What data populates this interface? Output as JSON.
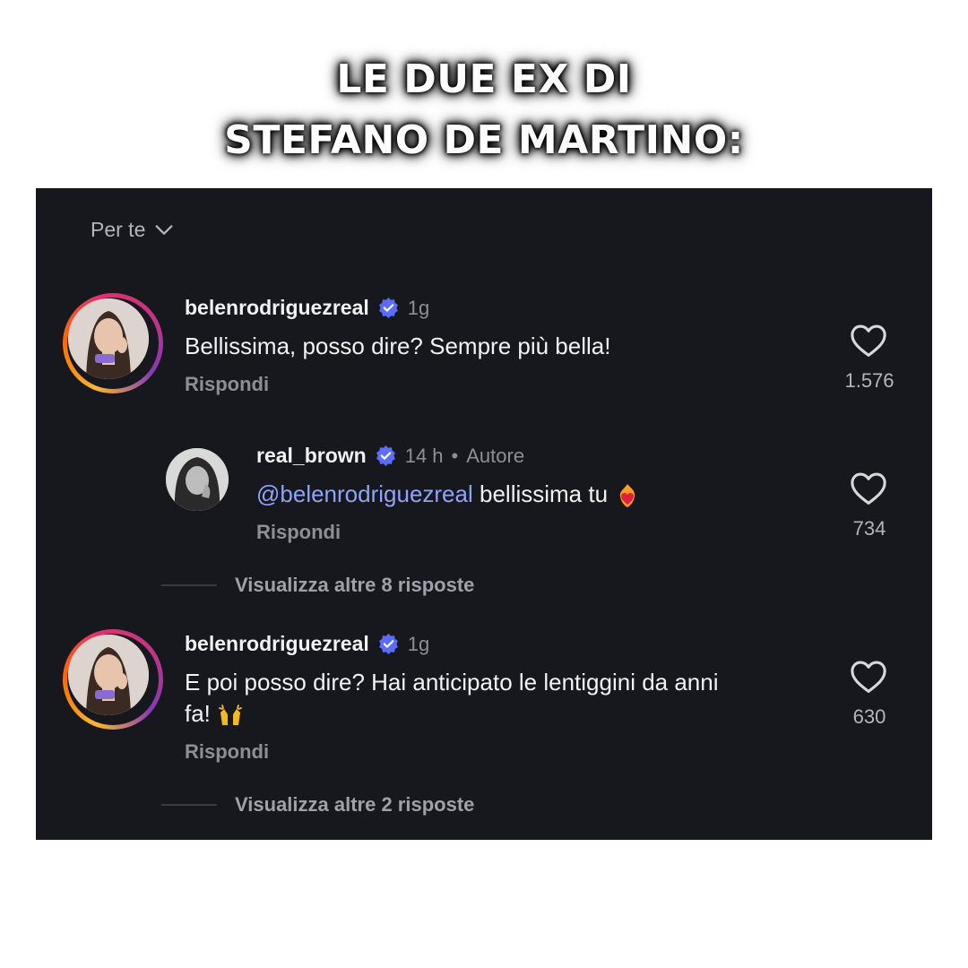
{
  "headline": {
    "line1": "LE DUE EX DI",
    "line2": "STEFANO DE MARTINO:"
  },
  "filter": {
    "label": "Per te",
    "icon": "chevron-down-icon"
  },
  "comments": [
    {
      "username": "belenrodriguezreal",
      "time": "1g",
      "text": "Bellissima, posso dire? Sempre più bella!",
      "reply_label": "Rispondi",
      "likes": "1.576"
    },
    {
      "username": "real_brown",
      "time": "14 h",
      "separator": "•",
      "role": "Autore",
      "mention": "@belenrodriguezreal",
      "text": "bellissima tu",
      "emoji": "heart-on-fire",
      "reply_label": "Rispondi",
      "likes": "734"
    },
    {
      "username": "belenrodriguezreal",
      "time": "1g",
      "text_line1": "E poi posso dire? Hai anticipato le lentiggini da anni",
      "text_line2": "fa!",
      "emoji": "raising-hands",
      "reply_label": "Rispondi",
      "likes": "630"
    }
  ],
  "view_more": [
    {
      "label": "Visualizza altre 8 risposte"
    },
    {
      "label": "Visualizza altre 2 risposte"
    }
  ],
  "colors": {
    "panel_bg": "#17181d",
    "verified": "#5b6cff",
    "mention": "#8ea3ff"
  }
}
